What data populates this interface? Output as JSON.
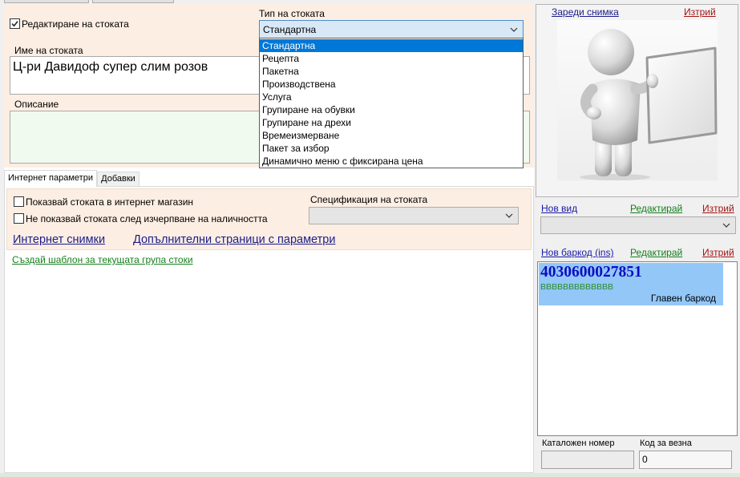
{
  "colors": {
    "panel_bg": "#fdeee3",
    "selection": "#0078d7",
    "barcode_selected_bg": "#92c7f8",
    "link_navy": "#1c1c8a",
    "link_blue": "#1a1aa8",
    "link_green": "#15801c",
    "link_red": "#a51414",
    "barcode_code": "#0d0dc2",
    "barcode_sub": "#2a8c2a",
    "description_bg": "#f0faef"
  },
  "icons": {
    "dropdown_arrow": "chevron-down-icon",
    "checkbox_mark": "checkmark-icon",
    "picture": "person-holding-board-image"
  },
  "product": {
    "edit_checkbox": {
      "label": "Редактиране на стоката",
      "checked": true
    },
    "type": {
      "label": "Тип на стоката",
      "selected": "Стандартна",
      "options": [
        "Стандартна",
        "Рецепта",
        "Пакетна",
        "Производствена",
        "Услуга",
        "Групиране на обувки",
        "Групиране на дрехи",
        "Времеизмерване",
        "Пакет за избор",
        "Динамично меню с фиксирана цена"
      ]
    },
    "name": {
      "label": "Име на стоката",
      "value": "Ц-ри Давидоф супер слим розов"
    },
    "description": {
      "label": "Описание",
      "value": ""
    }
  },
  "tabs": [
    {
      "label": "Интернет параметри"
    },
    {
      "label": "Добавки"
    }
  ],
  "internet": {
    "show_in_shop": {
      "label": "Показвай стоката в интернет магазин",
      "checked": false
    },
    "hide_when_out_of_stock": {
      "label": "Не показвай стоката след изчерпване на наличността",
      "checked": false
    },
    "specification": {
      "label": "Спецификация на стоката",
      "value": ""
    },
    "pictures_link": "Интернет снимки",
    "extra_pages_link": "Допълнителни страници с параметри"
  },
  "template_link": "Създай шаблон за текущата група стоки",
  "picture": {
    "load_link": "Зареди снимка",
    "delete_link": "Изтрий"
  },
  "kind": {
    "new_link": "Нов вид",
    "edit_link": "Редактирай",
    "delete_link": "Изтрий",
    "value": ""
  },
  "barcodes": {
    "new_link": "Нов баркод (ins)",
    "edit_link": "Редактирай",
    "delete_link": "Изтрий",
    "items": [
      {
        "code": "4030600027851",
        "secondary": "BBBBBBBBBBBBB",
        "tag": "Главен баркод"
      }
    ]
  },
  "catalog_number": {
    "label": "Каталожен номер",
    "value": ""
  },
  "scale_code": {
    "label": "Код за везна",
    "value": "0"
  }
}
